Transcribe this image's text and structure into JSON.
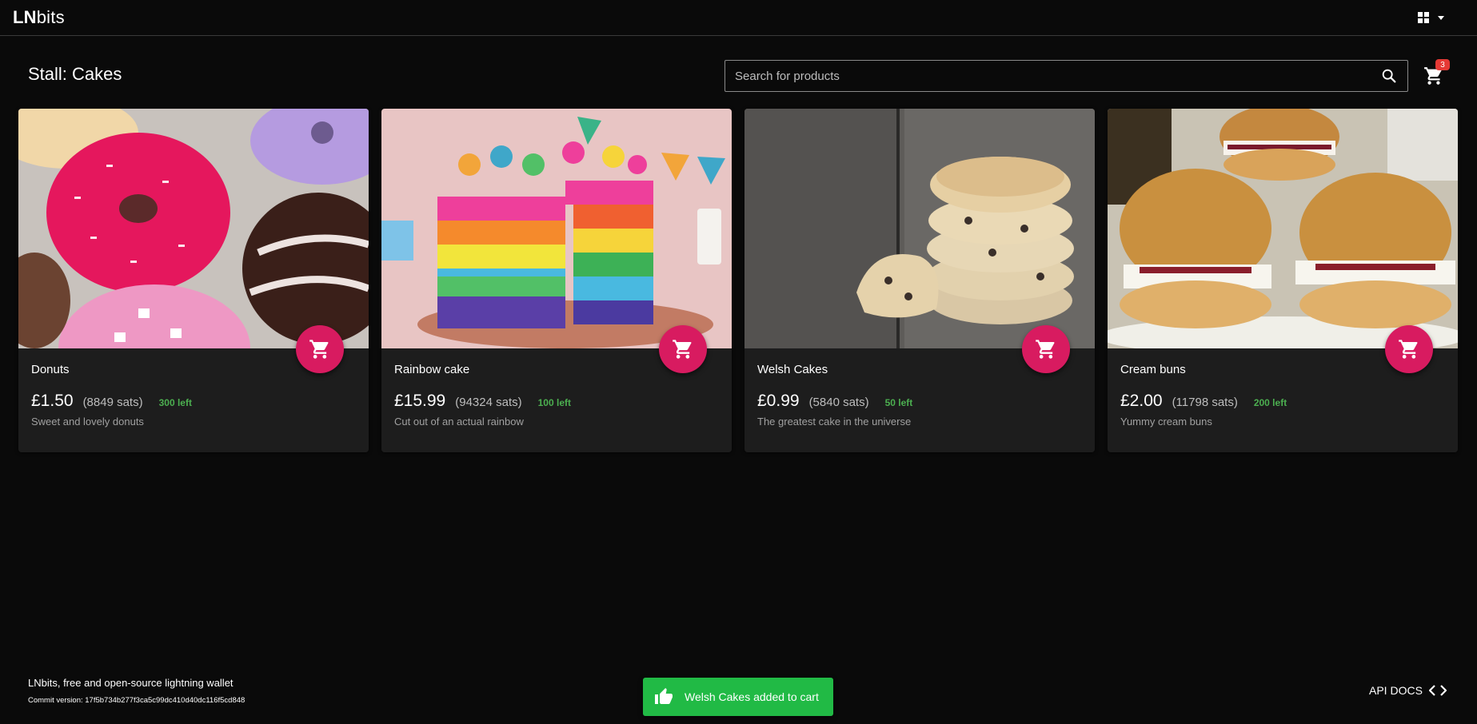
{
  "header": {
    "logo_bold": "LN",
    "logo_rest": "bits",
    "icons": [
      "apps-icon",
      "dropdown-arrow-icon",
      "dark-mode-moon-icon"
    ]
  },
  "stall": {
    "title": "Stall: Cakes"
  },
  "search": {
    "placeholder": "Search for products",
    "value": ""
  },
  "cart": {
    "count": "3",
    "badge_color": "#e53935"
  },
  "colors": {
    "background": "#0a0a0a",
    "card": "#1d1d1d",
    "accent": "#d81b60",
    "stock": "#4caf50",
    "toast": "#21ba45"
  },
  "products": [
    {
      "name": "Donuts",
      "price": "£1.50",
      "sats": "(8849 sats)",
      "left": "300 left",
      "description": "Sweet and lovely donuts",
      "image": "donuts-photo"
    },
    {
      "name": "Rainbow cake",
      "price": "£15.99",
      "sats": "(94324 sats)",
      "left": "100 left",
      "description": "Cut out of an actual rainbow",
      "image": "rainbow-cake-photo"
    },
    {
      "name": "Welsh Cakes",
      "price": "£0.99",
      "sats": "(5840 sats)",
      "left": "50 left",
      "description": "The greatest cake in the universe",
      "image": "welsh-cakes-photo"
    },
    {
      "name": "Cream buns",
      "price": "£2.00",
      "sats": "(11798 sats)",
      "left": "200 left",
      "description": "Yummy cream buns",
      "image": "cream-buns-photo"
    }
  ],
  "footer": {
    "text": "LNbits, free and open-source lightning wallet",
    "commit": "Commit version: 17f5b734b277f3ca5c99dc410d40dc116f5cd848",
    "api_docs": "API DOCS"
  },
  "toast": {
    "message": "Welsh Cakes added to cart"
  }
}
